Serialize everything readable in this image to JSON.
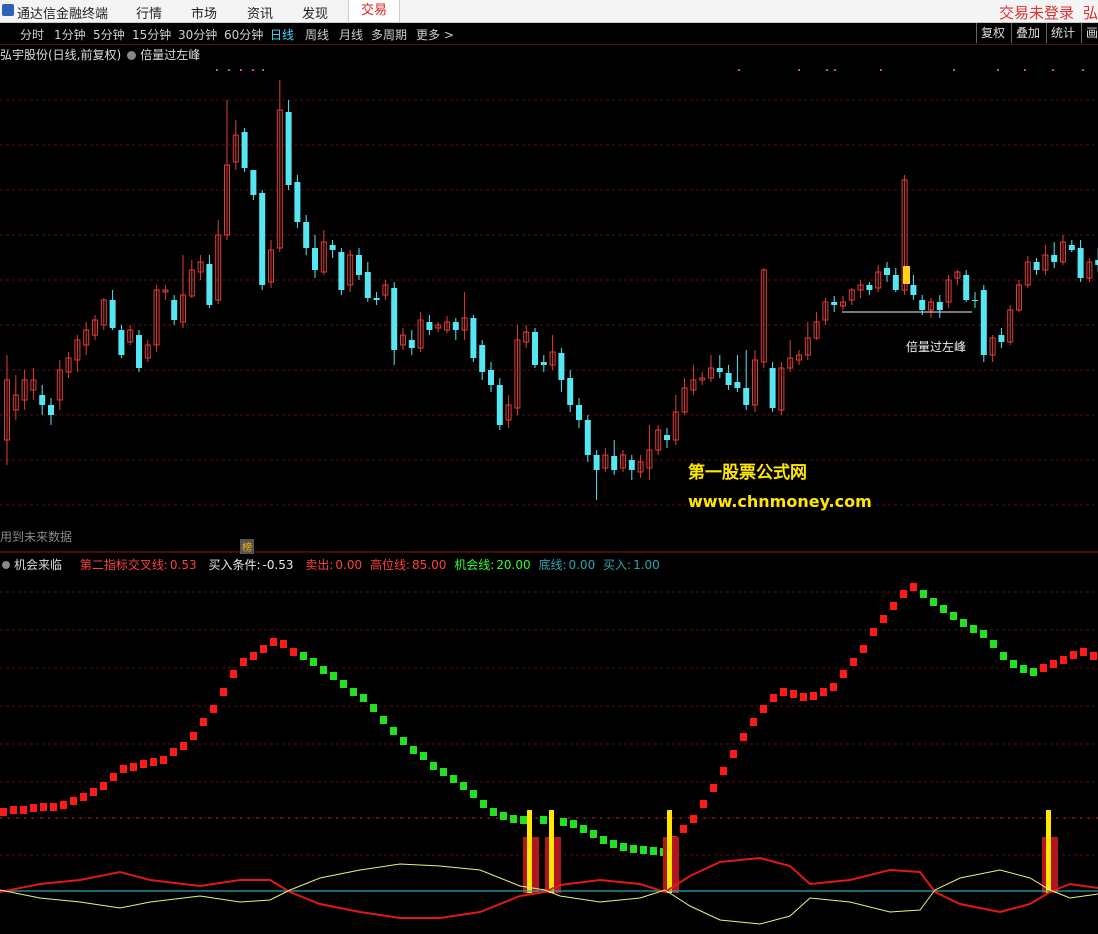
{
  "topbar": {
    "app_title": "通达信金融终端",
    "menus": [
      "行情",
      "市场",
      "资讯",
      "发现",
      "交易"
    ],
    "active_menu": "交易",
    "login_status": "交易未登录",
    "edge_text": "弘"
  },
  "periods": [
    "分时",
    "1分钟",
    "5分钟",
    "15分钟",
    "30分钟",
    "60分钟",
    "日线",
    "周线",
    "月线",
    "多周期",
    "更多 >"
  ],
  "selected_period": "日线",
  "right_buttons": [
    "复权",
    "叠加",
    "统计",
    "画"
  ],
  "stock_line": {
    "name": "弘宇股份(日线,前复权)",
    "indicator": "倍量过左峰"
  },
  "future_note": "用到未来数据",
  "rank_badge": "榜",
  "indicator_line": {
    "name": "机会来临",
    "items": [
      {
        "label": "第二指标交叉线:",
        "value": "0.53",
        "color": "#ff4040"
      },
      {
        "label": "买入条件:",
        "value": "-0.53",
        "color": "#e8e8e8"
      },
      {
        "label": "卖出:",
        "value": "0.00",
        "color": "#ff4040"
      },
      {
        "label": "高位线:",
        "value": "85.00",
        "color": "#ff4040"
      },
      {
        "label": "机会线:",
        "value": "20.00",
        "color": "#30ff30"
      },
      {
        "label": "底线:",
        "value": "0.00",
        "color": "#2aa6b0"
      },
      {
        "label": "买入:",
        "value": "1.00",
        "color": "#2aa6b0"
      }
    ]
  },
  "watermark": {
    "line1": "第一股票公式网",
    "line2": "www.chnmoney.com"
  },
  "peak_label": "倍量过左峰",
  "colors": {
    "up": "#e23b3b",
    "down": "#56e6f2",
    "bull": "#ff1a1a",
    "bear": "#22e022",
    "signal": "#ffe600",
    "grid": "#5a1010",
    "baseline": "#2aa6b0"
  },
  "chart_data": {
    "type": "candlestick",
    "candles": [
      [
        440,
        380,
        465,
        355
      ],
      [
        410,
        395,
        420,
        375
      ],
      [
        400,
        380,
        410,
        370
      ],
      [
        390,
        380,
        400,
        368
      ],
      [
        395,
        405,
        415,
        385
      ],
      [
        405,
        415,
        425,
        398
      ],
      [
        400,
        370,
        410,
        360
      ],
      [
        372,
        358,
        378,
        352
      ],
      [
        360,
        340,
        372,
        335
      ],
      [
        345,
        330,
        355,
        322
      ],
      [
        335,
        320,
        340,
        315
      ],
      [
        325,
        300,
        330,
        298
      ],
      [
        300,
        328,
        330,
        290
      ],
      [
        330,
        355,
        358,
        325
      ],
      [
        342,
        330,
        345,
        325
      ],
      [
        335,
        368,
        372,
        330
      ],
      [
        358,
        345,
        362,
        340
      ],
      [
        345,
        290,
        352,
        285
      ],
      [
        292,
        290,
        300,
        285
      ],
      [
        300,
        320,
        325,
        295
      ],
      [
        322,
        295,
        328,
        255
      ],
      [
        296,
        270,
        298,
        260
      ],
      [
        272,
        262,
        280,
        255
      ],
      [
        264,
        305,
        308,
        255
      ],
      [
        300,
        235,
        304,
        220
      ],
      [
        235,
        165,
        240,
        100
      ],
      [
        162,
        135,
        170,
        120
      ],
      [
        132,
        168,
        172,
        128
      ],
      [
        170,
        195,
        200,
        185
      ],
      [
        193,
        285,
        290,
        190
      ],
      [
        282,
        250,
        288,
        240
      ],
      [
        248,
        110,
        252,
        80
      ],
      [
        112,
        185,
        190,
        100
      ],
      [
        182,
        222,
        228,
        175
      ],
      [
        222,
        248,
        255,
        215
      ],
      [
        248,
        270,
        278,
        235
      ],
      [
        272,
        242,
        275,
        230
      ],
      [
        245,
        250,
        258,
        240
      ],
      [
        252,
        290,
        295,
        248
      ],
      [
        285,
        255,
        292,
        250
      ],
      [
        255,
        275,
        280,
        248
      ],
      [
        272,
        298,
        302,
        262
      ],
      [
        298,
        300,
        305,
        292
      ],
      [
        295,
        285,
        300,
        280
      ],
      [
        288,
        350,
        365,
        282
      ],
      [
        345,
        335,
        350,
        328
      ],
      [
        340,
        348,
        355,
        330
      ],
      [
        348,
        320,
        352,
        312
      ],
      [
        322,
        330,
        335,
        315
      ],
      [
        328,
        325,
        332,
        322
      ],
      [
        330,
        322,
        333,
        316
      ],
      [
        322,
        330,
        340,
        318
      ],
      [
        330,
        318,
        340,
        292
      ],
      [
        318,
        358,
        362,
        315
      ],
      [
        345,
        372,
        380,
        340
      ],
      [
        370,
        385,
        392,
        362
      ],
      [
        385,
        425,
        430,
        378
      ],
      [
        420,
        405,
        428,
        395
      ],
      [
        408,
        340,
        415,
        325
      ],
      [
        342,
        332,
        348,
        325
      ],
      [
        332,
        365,
        368,
        328
      ],
      [
        362,
        365,
        372,
        355
      ],
      [
        365,
        352,
        370,
        335
      ],
      [
        353,
        380,
        392,
        348
      ],
      [
        378,
        405,
        412,
        370
      ],
      [
        405,
        420,
        428,
        398
      ],
      [
        420,
        455,
        462,
        415
      ],
      [
        455,
        470,
        500,
        450
      ],
      [
        468,
        455,
        472,
        448
      ],
      [
        456,
        470,
        475,
        440
      ],
      [
        468,
        455,
        472,
        450
      ],
      [
        460,
        470,
        480,
        455
      ],
      [
        472,
        462,
        478,
        455
      ],
      [
        468,
        450,
        480,
        425
      ],
      [
        450,
        430,
        455,
        425
      ],
      [
        435,
        440,
        448,
        428
      ],
      [
        440,
        412,
        445,
        395
      ],
      [
        412,
        388,
        415,
        378
      ],
      [
        390,
        380,
        395,
        365
      ],
      [
        380,
        378,
        385,
        372
      ],
      [
        378,
        368,
        382,
        355
      ],
      [
        368,
        372,
        378,
        355
      ],
      [
        373,
        385,
        390,
        365
      ],
      [
        382,
        388,
        392,
        355
      ],
      [
        388,
        405,
        410,
        350
      ],
      [
        405,
        360,
        412,
        350
      ],
      [
        362,
        270,
        368,
        268
      ],
      [
        368,
        408,
        412,
        362
      ],
      [
        410,
        368,
        415,
        362
      ],
      [
        368,
        358,
        372,
        340
      ],
      [
        360,
        355,
        365,
        350
      ],
      [
        355,
        338,
        360,
        322
      ],
      [
        338,
        322,
        340,
        312
      ],
      [
        320,
        302,
        325,
        298
      ],
      [
        302,
        305,
        312,
        296
      ],
      [
        306,
        302,
        310,
        296
      ],
      [
        300,
        290,
        305,
        288
      ],
      [
        290,
        285,
        298,
        280
      ],
      [
        285,
        290,
        295,
        282
      ],
      [
        288,
        272,
        292,
        265
      ],
      [
        268,
        275,
        282,
        262
      ],
      [
        275,
        290,
        292,
        268
      ],
      [
        290,
        180,
        295,
        175
      ],
      [
        285,
        295,
        300,
        275
      ],
      [
        300,
        310,
        315,
        295
      ],
      [
        310,
        302,
        318,
        298
      ],
      [
        302,
        310,
        318,
        295
      ],
      [
        302,
        280,
        308,
        275
      ],
      [
        278,
        272,
        285,
        270
      ],
      [
        275,
        300,
        302,
        270
      ],
      [
        300,
        300,
        308,
        292
      ],
      [
        290,
        355,
        362,
        285
      ],
      [
        355,
        338,
        362,
        335
      ],
      [
        335,
        342,
        348,
        328
      ],
      [
        342,
        310,
        345,
        305
      ],
      [
        310,
        285,
        312,
        280
      ],
      [
        285,
        262,
        288,
        256
      ],
      [
        262,
        270,
        275,
        258
      ],
      [
        270,
        255,
        275,
        245
      ],
      [
        255,
        262,
        268,
        242
      ],
      [
        262,
        242,
        265,
        235
      ],
      [
        245,
        250,
        252,
        240
      ],
      [
        248,
        278,
        282,
        240
      ],
      [
        278,
        262,
        282,
        258
      ],
      [
        260,
        265,
        272,
        248
      ]
    ],
    "signal_bars": [
      {
        "index": 34,
        "type": "buy"
      },
      {
        "index": 35,
        "type": "buy"
      },
      {
        "index": 42,
        "type": "buy"
      },
      {
        "index": 62,
        "type": "buy"
      }
    ]
  }
}
